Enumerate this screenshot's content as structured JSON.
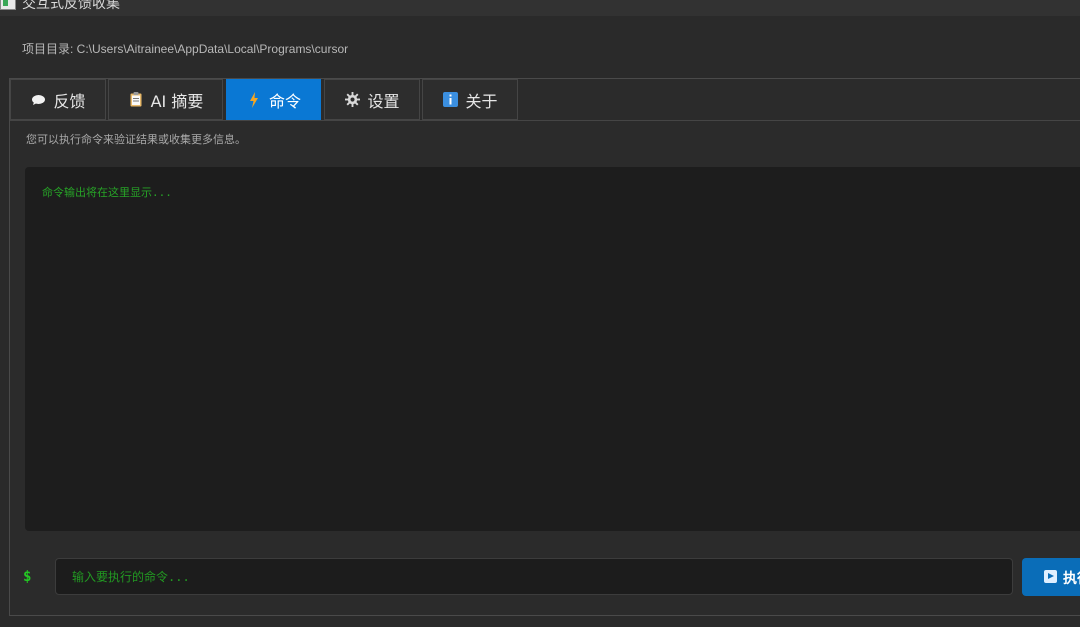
{
  "window": {
    "title": "交互式反馈收集"
  },
  "project": {
    "dir_text": "项目目录: C:\\Users\\Aitrainee\\AppData\\Local\\Programs\\cursor"
  },
  "tabs": [
    {
      "label": "反馈",
      "icon": "speech-bubble-icon",
      "active": false
    },
    {
      "label": "AI 摘要",
      "icon": "clipboard-icon",
      "active": false
    },
    {
      "label": "命令",
      "icon": "lightning-icon",
      "active": true
    },
    {
      "label": "设置",
      "icon": "gear-icon",
      "active": false
    },
    {
      "label": "关于",
      "icon": "info-icon",
      "active": false
    }
  ],
  "command": {
    "hint": "您可以执行命令来验证结果或收集更多信息。",
    "output_placeholder": "命令输出将在这里显示...",
    "prompt_symbol": "$",
    "input_placeholder": "输入要执行的命令...",
    "input_value": "",
    "run_label": "执行"
  },
  "colors": {
    "accent": "#0a78d4",
    "terminal_green": "#23c823",
    "background": "#2a2a2a"
  }
}
